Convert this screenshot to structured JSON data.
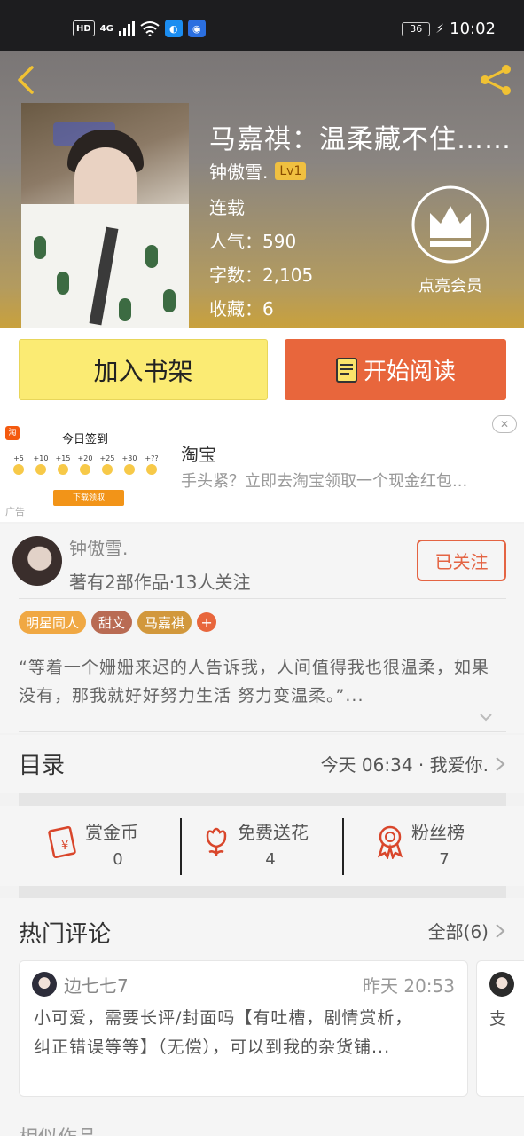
{
  "status_bar": {
    "hd": "HD",
    "network": "4G",
    "battery": "36",
    "time": "10:02"
  },
  "book": {
    "title": "马嘉祺：温柔藏不住……",
    "author": "钟傲雪.",
    "author_level": "Lv1",
    "status": "连载",
    "popularity_label": "人气：",
    "popularity": "590",
    "words_label": "字数：",
    "words": "2,105",
    "favorites_label": "收藏：",
    "favorites": "6",
    "vip_label": "点亮会员"
  },
  "actions": {
    "add_shelf": "加入书架",
    "start_read": "开始阅读"
  },
  "ad": {
    "thumb_title": "今日签到",
    "thumb_logo": "淘",
    "coins": [
      "+5",
      "+10",
      "+15",
      "+20",
      "+25",
      "+30",
      "+??"
    ],
    "download": "下载领取",
    "ad_mark": "广告",
    "name": "淘宝",
    "desc": "手头紧？立即去淘宝领取一个现金红包...",
    "close": "✕"
  },
  "author_card": {
    "name": "钟傲雪.",
    "stats": "著有2部作品·13人关注",
    "follow": "已关注",
    "tags": [
      {
        "label": "明星同人",
        "color": "#f0a843"
      },
      {
        "label": "甜文",
        "color": "#b96b53"
      },
      {
        "label": "马嘉祺",
        "color": "#d2983c"
      }
    ],
    "summary": "“等着一个姗姗来迟的人告诉我，人间值得我也很温柔，如果没有，那我就好好努力生活 努力变温柔。”..."
  },
  "toc": {
    "label": "目录",
    "latest": "今天 06:34 · 我爱你."
  },
  "stats": [
    {
      "label": "赏金币",
      "value": "0",
      "icon": "red-envelope-icon"
    },
    {
      "label": "免费送花",
      "value": "4",
      "icon": "flower-icon"
    },
    {
      "label": "粉丝榜",
      "value": "7",
      "icon": "medal-icon"
    }
  ],
  "comments": {
    "label": "热门评论",
    "all": "全部(6)",
    "item": {
      "user": "边七七7",
      "time": "昨天 20:53",
      "line1": "小可爱，需要长评/封面吗【有吐槽，剧情赏析，",
      "line2": "纠正错误等等】（无偿），可以到我的杂货铺..."
    },
    "next_snippet": "支",
    "similar": "相似作品"
  },
  "colors": {
    "accent": "#e8663c",
    "shelf": "#fbeb73",
    "follow": "#e46443"
  }
}
